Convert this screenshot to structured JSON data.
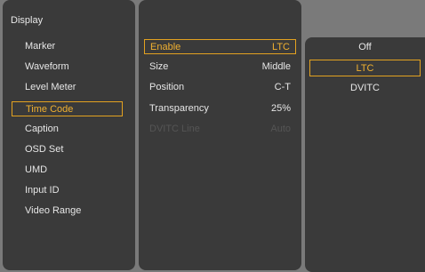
{
  "menu_title": "Display",
  "left_menu": [
    {
      "label": "Marker"
    },
    {
      "label": "Waveform"
    },
    {
      "label": "Level Meter"
    },
    {
      "label": "Time Code"
    },
    {
      "label": "Caption"
    },
    {
      "label": "OSD Set"
    },
    {
      "label": "UMD"
    },
    {
      "label": "Input ID"
    },
    {
      "label": "Video Range"
    }
  ],
  "settings": [
    {
      "label": "Enable",
      "value": "LTC"
    },
    {
      "label": "Size",
      "value": "Middle"
    },
    {
      "label": "Position",
      "value": "C-T"
    },
    {
      "label": "Transparency",
      "value": "25%"
    },
    {
      "label": "DVITC Line",
      "value": "Auto"
    }
  ],
  "options": [
    "Off",
    "LTC",
    "DVITC"
  ],
  "colors": {
    "accent": "#e3a220",
    "panel": "#3a3a3a",
    "background": "#7a7a7a"
  }
}
